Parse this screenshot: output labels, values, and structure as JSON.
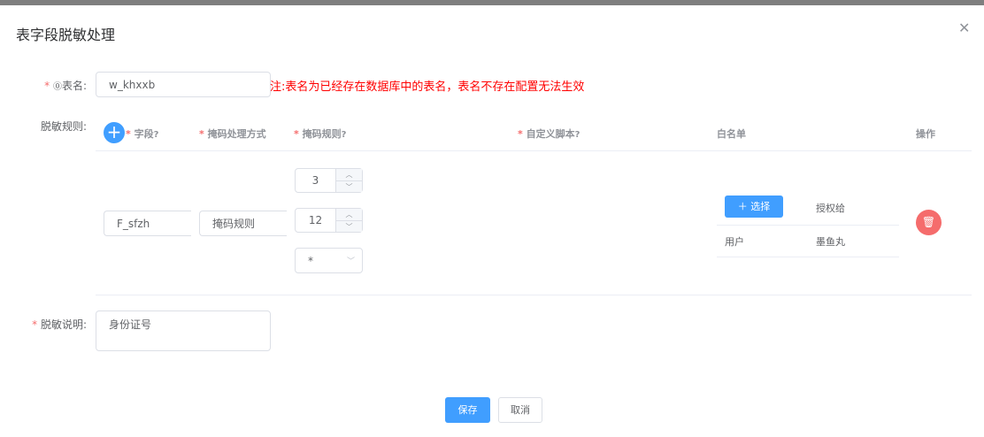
{
  "dialog": {
    "title": "表字段脱敏处理",
    "close_icon": "close-icon"
  },
  "form": {
    "table_name": {
      "label": "表名:",
      "value": "w_khxxb",
      "note": "注:表名为已经存在数据库中的表名，表名不存在配置无法生效"
    },
    "rules": {
      "label": "脱敏规则:",
      "columns": {
        "field": "字段",
        "mask_method": "掩码处理方式",
        "mask_rule": "掩码规则",
        "custom_script": "自定义脚本",
        "whitelist": "白名单",
        "action": "操作"
      },
      "row": {
        "field": "F_sfzh",
        "mask_method": "掩码规则",
        "start": "3",
        "end": "12",
        "mask_char": "*",
        "whitelist": {
          "select_label": "选择",
          "grant_header": "授权给",
          "entries": [
            {
              "type": "用户",
              "name": "墨鱼丸"
            }
          ]
        }
      }
    },
    "description": {
      "label": "脱敏说明:",
      "value": "身份证号"
    }
  },
  "footer": {
    "save": "保存",
    "cancel": "取消"
  },
  "colors": {
    "primary": "#409eff",
    "danger": "#f56c6c"
  }
}
